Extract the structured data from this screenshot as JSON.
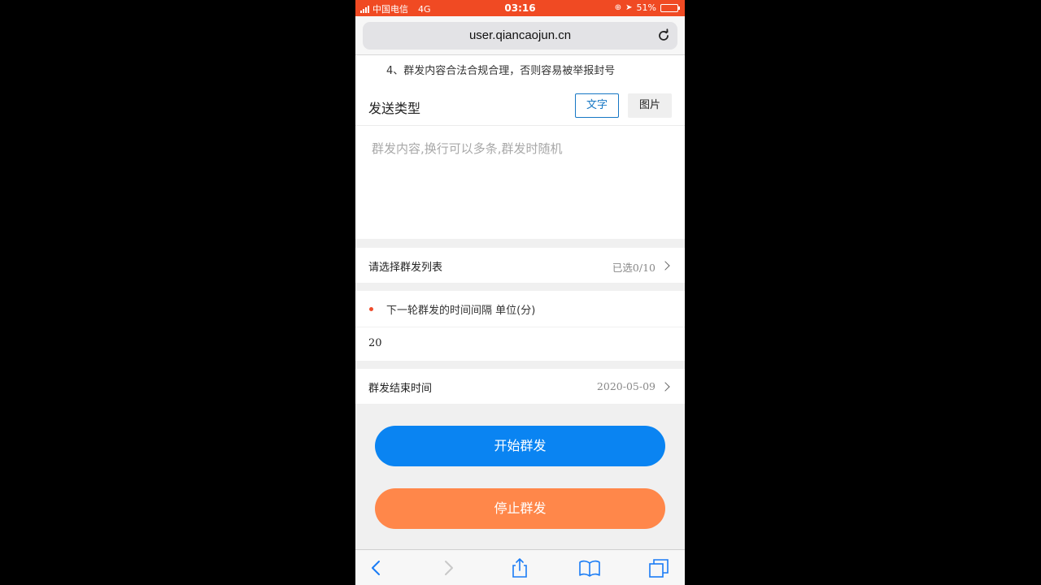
{
  "status_bar": {
    "carrier": "中国电信",
    "network": "4G",
    "time": "03:16",
    "battery_percent": "51%",
    "battery_level": 0.51
  },
  "browser": {
    "url": "user.qiancaojun.cn",
    "reload_icon": "reload-icon"
  },
  "notice": {
    "text": "4、群发内容合法合规合理，否则容易被举报封号"
  },
  "send_type": {
    "title": "发送类型",
    "options": [
      "文字",
      "图片"
    ],
    "selected": "文字",
    "content_placeholder": "群发内容,换行可以多条,群发时随机"
  },
  "group_list": {
    "label": "请选择群发列表",
    "value": "已选0/10"
  },
  "interval": {
    "label": "下一轮群发的时间间隔 单位(分)",
    "value": "20"
  },
  "end_time": {
    "label": "群发结束时间",
    "value": "2020-05-09"
  },
  "actions": {
    "start_label": "开始群发",
    "stop_label": "停止群发"
  },
  "colors": {
    "status_bar": "#f04a23",
    "primary": "#0a84f2",
    "stop": "#ff874a",
    "selected_border": "#1677c4"
  },
  "toolbar_icons": [
    "back-icon",
    "forward-icon",
    "share-icon",
    "bookmarks-icon",
    "tabs-icon"
  ]
}
